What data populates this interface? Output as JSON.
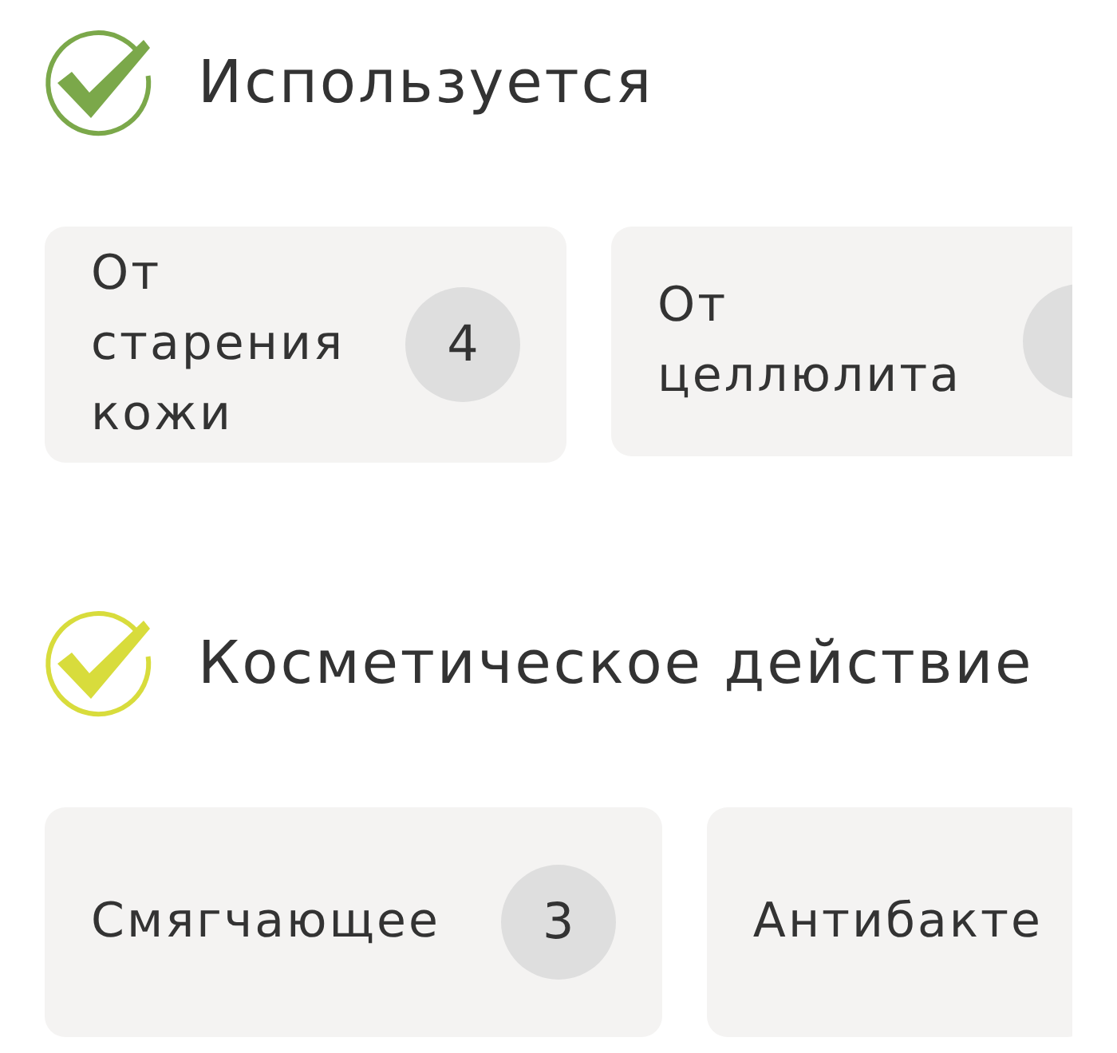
{
  "sections": [
    {
      "title": "Используется",
      "color": "#7ba84a",
      "items": [
        {
          "label": "От старения кожи",
          "count": "4",
          "has_count": true
        },
        {
          "label": "От целлюлита",
          "has_count": true
        }
      ]
    },
    {
      "title": "Косметическое действие",
      "color": "#d8dc3c",
      "items": [
        {
          "label": "Смягчающее",
          "count": "3",
          "has_count": true
        },
        {
          "label": "Антибакте",
          "has_count": false
        }
      ]
    }
  ]
}
